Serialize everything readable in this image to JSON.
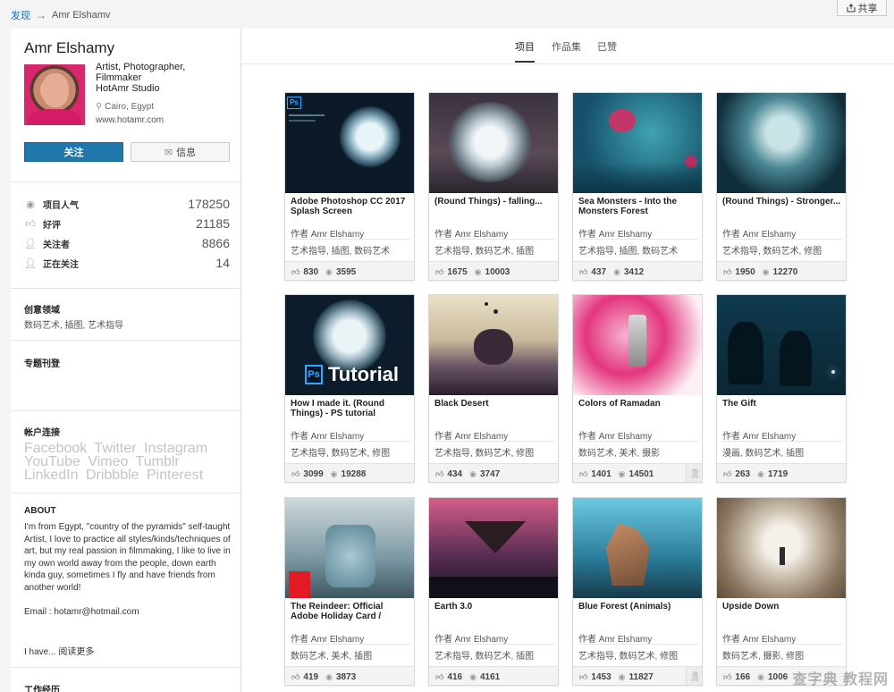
{
  "breadcrumb": {
    "root": "发现",
    "current": "Amr Elshamv"
  },
  "share_label": "共享",
  "profile": {
    "name": "Amr Elshamy",
    "bio_lines": [
      "Artist, Photographer,",
      "Filmmaker",
      "HotAmr Studio"
    ],
    "location": "Cairo, Egypt",
    "website": "www.hotamr.com",
    "follow_label": "关注",
    "message_label": "信息"
  },
  "stats": [
    {
      "icon": "eye-icon",
      "label": "项目人气",
      "value": "178250"
    },
    {
      "icon": "thumbs-up-icon",
      "label": "好评",
      "value": "21185"
    },
    {
      "icon": "follower-icon",
      "label": "关注者",
      "value": "8866"
    },
    {
      "icon": "following-icon",
      "label": "正在关注",
      "value": "14"
    }
  ],
  "fields": {
    "title": "创意领域",
    "text": "数码艺术, 插图, 艺术指导"
  },
  "featured": {
    "title": "专题刊登"
  },
  "links": {
    "title": "帐户连接",
    "items": [
      "Facebook",
      "Twitter",
      "Instagram",
      "YouTube",
      "Vimeo",
      "Tumblr",
      "LinkedIn",
      "Dribbble",
      "Pinterest"
    ]
  },
  "about": {
    "title": "ABOUT",
    "text": "I'm from Egypt, \"country of the pyramids\" self-taught Artist, I love to practice all styles/kinds/techniques of art, but my real passion in filmmaking, I like to live in my own world away from the people, down earth kinda guy, sometimes I fly and have friends from another world!\n\nEmail : hotamr@hotmail.com",
    "more": "I have... 阅读更多"
  },
  "experience_title": "工作经历",
  "tabs": [
    {
      "label": "项目",
      "active": true
    },
    {
      "label": "作品集",
      "active": false
    },
    {
      "label": "已赞",
      "active": false
    }
  ],
  "projects": [
    {
      "title": "Adobe Photoshop CC 2017 Splash Screen",
      "author": "作者 Amr Elshamy",
      "tags": "艺术指导, 插图, 数码艺术",
      "likes": "830",
      "views": "3595",
      "badge": false
    },
    {
      "title": "(Round Things) - falling...",
      "author": "作者 Amr Elshamy",
      "tags": "艺术指导, 数码艺术, 插图",
      "likes": "1675",
      "views": "10003",
      "badge": false
    },
    {
      "title": "Sea Monsters - Into the Monsters Forest",
      "author": "作者 Amr Elshamy",
      "tags": "艺术指导, 插图, 数码艺术",
      "likes": "437",
      "views": "3412",
      "badge": false
    },
    {
      "title": "(Round Things) - Stronger...",
      "author": "作者 Amr Elshamy",
      "tags": "艺术指导, 数码艺术, 修图",
      "likes": "1950",
      "views": "12270",
      "badge": false
    },
    {
      "title": "How I made it. (Round Things) - PS tutorial",
      "author": "作者 Amr Elshamy",
      "tags": "艺术指导, 数码艺术, 修图",
      "likes": "3099",
      "views": "19288",
      "badge": false
    },
    {
      "title": "Black Desert",
      "author": "作者 Amr Elshamy",
      "tags": "艺术指导, 数码艺术, 修图",
      "likes": "434",
      "views": "3747",
      "badge": false
    },
    {
      "title": "Colors of Ramadan",
      "author": "作者 Amr Elshamy",
      "tags": "数码艺术, 美术, 摄影",
      "likes": "1401",
      "views": "14501",
      "badge": true
    },
    {
      "title": "The Gift",
      "author": "作者 Amr Elshamy",
      "tags": "漫画, 数码艺术, 插图",
      "likes": "263",
      "views": "1719",
      "badge": false
    },
    {
      "title": "The Reindeer: Official Adobe Holiday Card /",
      "author": "作者 Amr Elshamy",
      "tags": "数码艺术, 美术, 插图",
      "likes": "419",
      "views": "3873",
      "badge": false
    },
    {
      "title": "Earth 3.0",
      "author": "作者 Amr Elshamy",
      "tags": "艺术指导, 数码艺术, 插图",
      "likes": "416",
      "views": "4161",
      "badge": false
    },
    {
      "title": "Blue Forest (Animals)",
      "author": "作者 Amr Elshamy",
      "tags": "艺术指导, 数码艺术, 修图",
      "likes": "1453",
      "views": "11827",
      "badge": true
    },
    {
      "title": "Upside Down",
      "author": "作者 Amr Elshamy",
      "tags": "数码艺术, 摄影, 修图",
      "likes": "166",
      "views": "1006",
      "badge": false
    }
  ],
  "thumb_text": {
    "tutorial": "Tutorial",
    "ps": "Ps"
  },
  "watermark": "查字典 教程网"
}
